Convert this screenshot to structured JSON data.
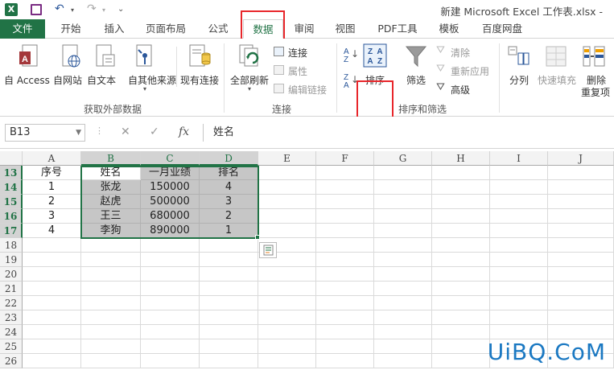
{
  "window": {
    "title": "新建 Microsoft Excel 工作表.xlsx -"
  },
  "tabs": [
    {
      "label": "文件"
    },
    {
      "label": "开始"
    },
    {
      "label": "插入"
    },
    {
      "label": "页面布局"
    },
    {
      "label": "公式"
    },
    {
      "label": "数据"
    },
    {
      "label": "审阅"
    },
    {
      "label": "视图"
    },
    {
      "label": "PDF工具"
    },
    {
      "label": "模板"
    },
    {
      "label": "百度网盘"
    }
  ],
  "ribbon": {
    "external": {
      "group_label": "获取外部数据",
      "access": "自 Access",
      "web": "自网站",
      "text": "自文本",
      "other": "自其他来源",
      "existing": "现有连接"
    },
    "connections": {
      "group_label": "连接",
      "refresh_all": "全部刷新",
      "connections": "连接",
      "properties": "属性",
      "edit_links": "编辑链接"
    },
    "sort_filter": {
      "group_label": "排序和筛选",
      "sort": "排序",
      "filter": "筛选",
      "clear": "清除",
      "reapply": "重新应用",
      "advanced": "高级"
    },
    "data_tools": {
      "text_to_columns": "分列",
      "flash_fill": "快速填充",
      "remove_dup_1": "删除",
      "remove_dup_2": "重复项"
    }
  },
  "formula_bar": {
    "name_box": "B13",
    "content": "姓名"
  },
  "columns": [
    "A",
    "B",
    "C",
    "D",
    "E",
    "F",
    "G",
    "H",
    "I",
    "J"
  ],
  "rows": [
    "13",
    "14",
    "15",
    "16",
    "17",
    "18",
    "19",
    "20",
    "21",
    "22",
    "23",
    "24",
    "25",
    "26"
  ],
  "table": {
    "headers": [
      "序号",
      "姓名",
      "一月业绩",
      "排名"
    ],
    "data": [
      [
        "1",
        "张龙",
        "150000",
        "4"
      ],
      [
        "2",
        "赵虎",
        "500000",
        "3"
      ],
      [
        "3",
        "王三",
        "680000",
        "2"
      ],
      [
        "4",
        "李狗",
        "890000",
        "1"
      ]
    ]
  },
  "watermark": "UiBQ.CoM"
}
